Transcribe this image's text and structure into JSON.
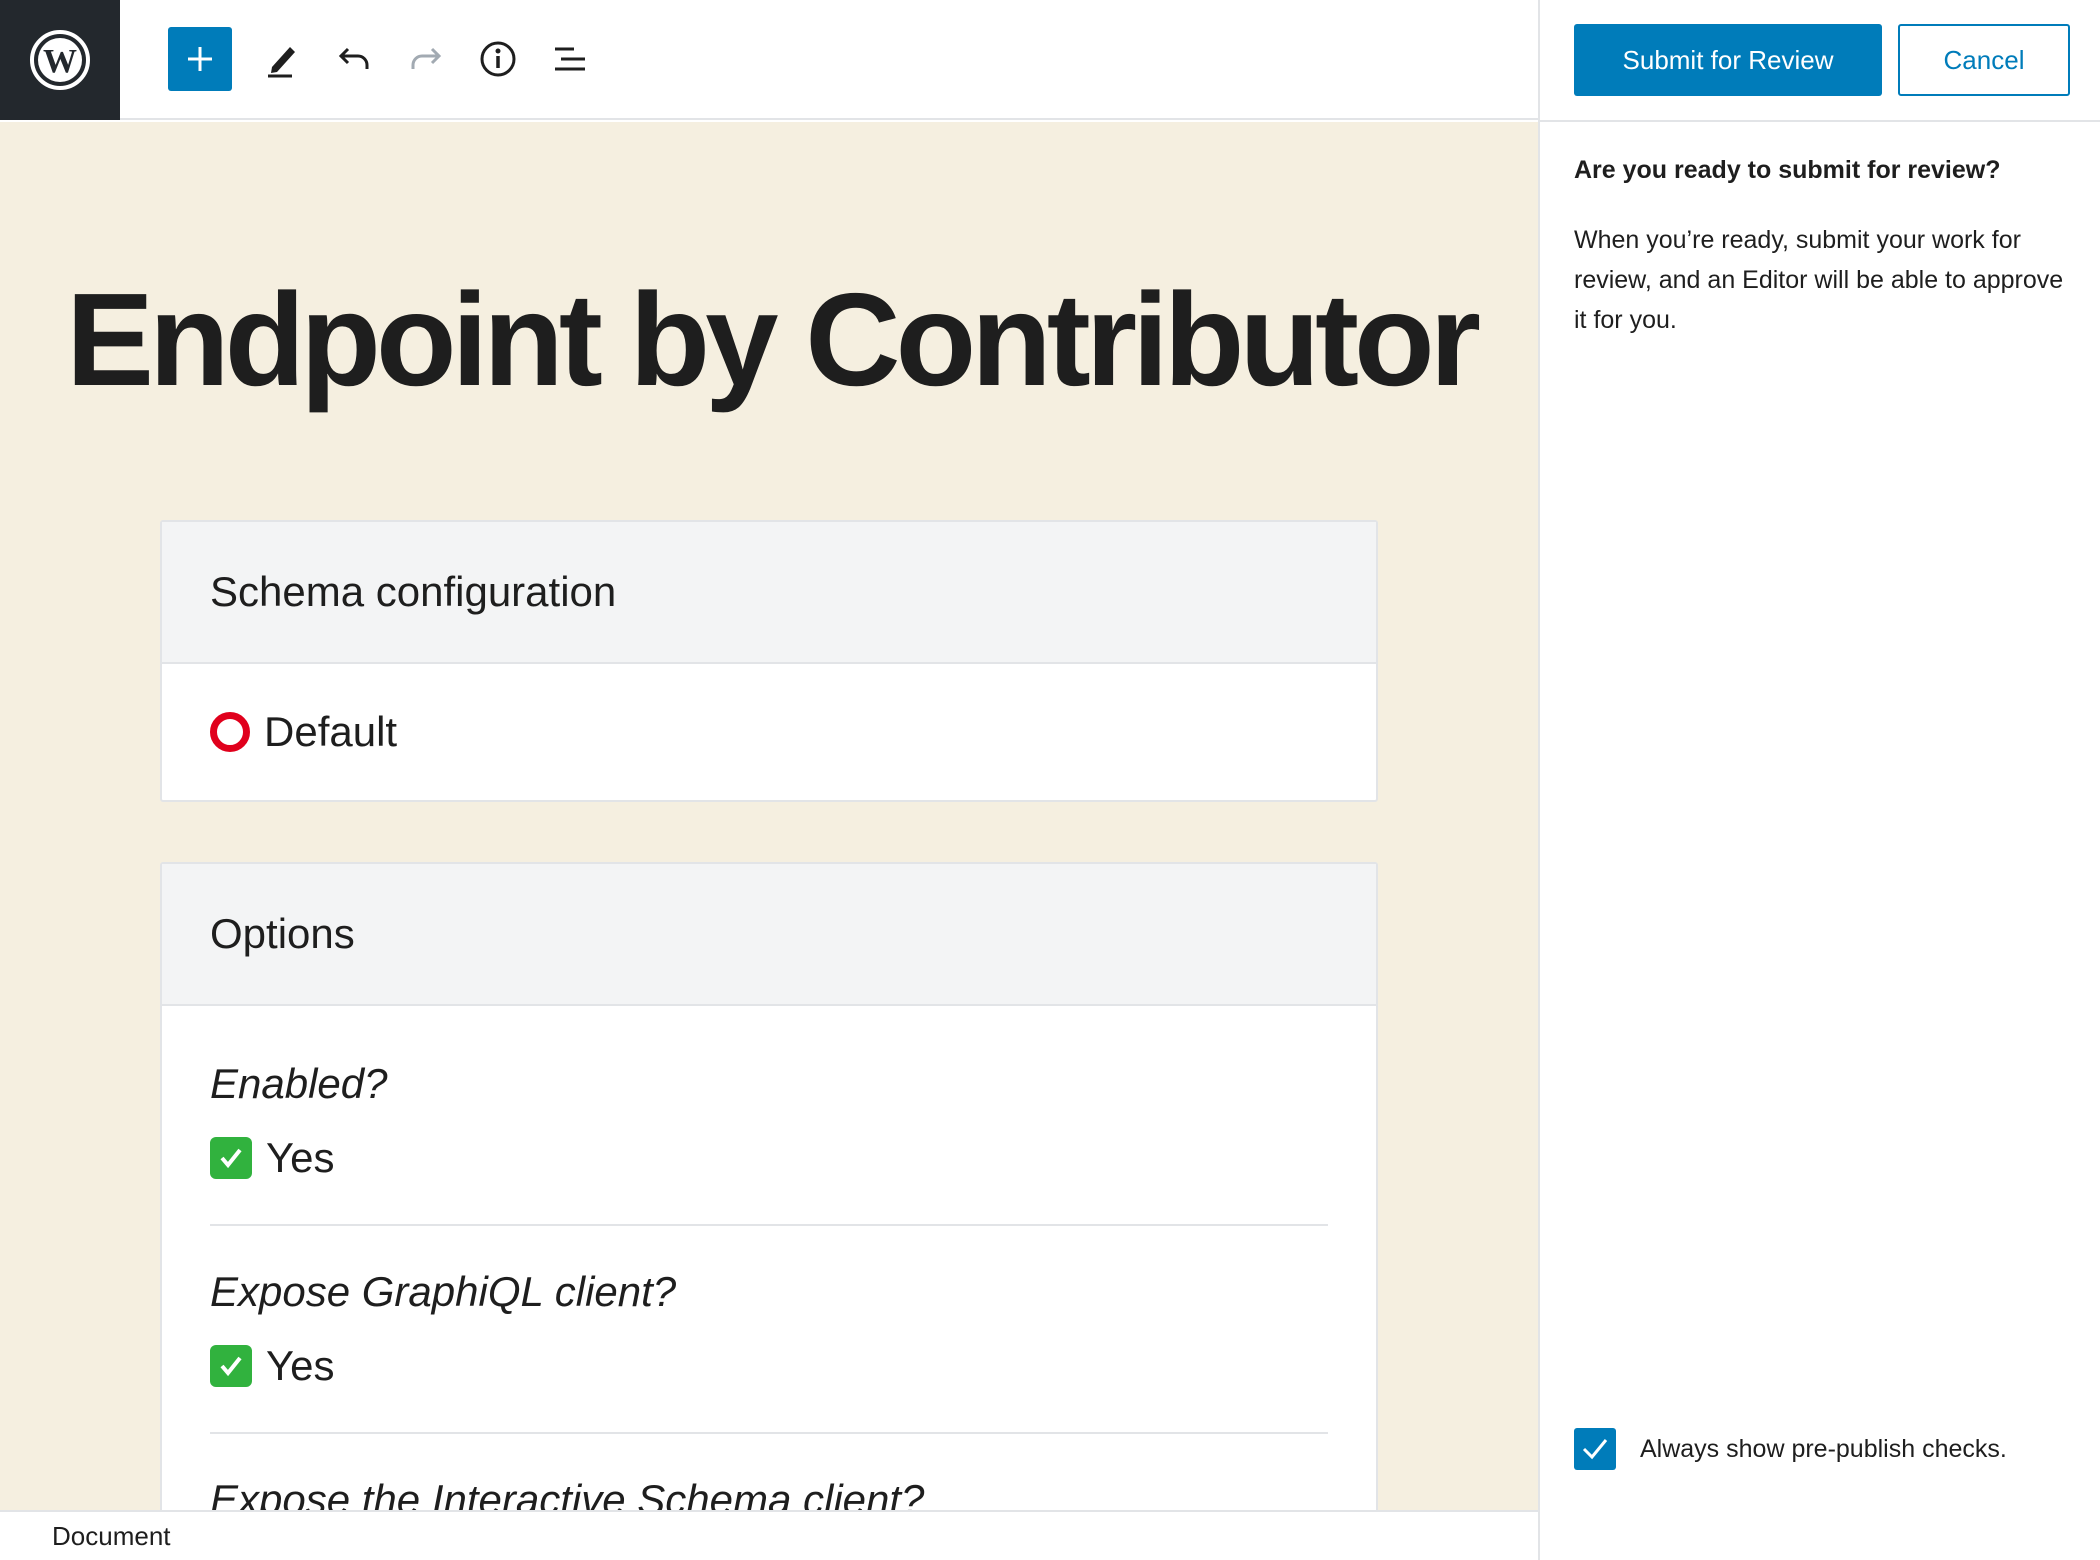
{
  "toolbar": {
    "logo_icon": "wordpress-icon",
    "tools": [
      "add-block-icon",
      "edit-icon",
      "undo-icon",
      "redo-icon",
      "info-icon",
      "block-navigation-icon"
    ]
  },
  "post": {
    "title": "Endpoint by Contributor"
  },
  "schema_panel": {
    "heading": "Schema configuration",
    "value": "Default"
  },
  "options_panel": {
    "heading": "Options",
    "items": [
      {
        "question": "Enabled?",
        "answer": "Yes"
      },
      {
        "question": "Expose GraphiQL client?",
        "answer": "Yes"
      },
      {
        "question": "Expose the Interactive Schema client?",
        "answer": ""
      }
    ]
  },
  "footer": {
    "breadcrumb": "Document"
  },
  "sidebar": {
    "submit_label": "Submit for Review",
    "cancel_label": "Cancel",
    "question": "Are you ready to submit for review?",
    "description": "When you’re ready, submit your work for review, and an Editor will be able to approve it for you.",
    "checkbox_label": "Always show pre-publish checks.",
    "checkbox_checked": true
  },
  "colors": {
    "accent": "#007cba",
    "canvas": "#f5efe0",
    "check_green": "#31b23e",
    "circle_red": "#e0001c"
  }
}
